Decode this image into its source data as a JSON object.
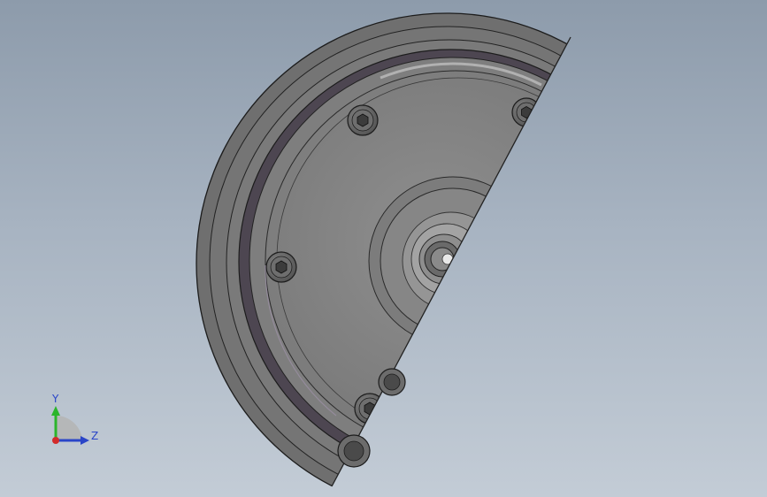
{
  "viewport": {
    "background_top": "#8d9bab",
    "background_bottom": "#c3ccd6",
    "model": "section-view-disc-assembly"
  },
  "triad": {
    "axes": [
      {
        "label": "Y",
        "color": "#2bb52b"
      },
      {
        "label": "Z",
        "color": "#2a45c8"
      },
      {
        "label": "X",
        "color": "#d22b2b"
      }
    ]
  },
  "colors": {
    "disc_body": "#7c7c7c",
    "disc_face": "#8a8a8a",
    "groove": "#4a4350",
    "edge": "#1c1c1c",
    "bolt": "#6a6a6a"
  }
}
